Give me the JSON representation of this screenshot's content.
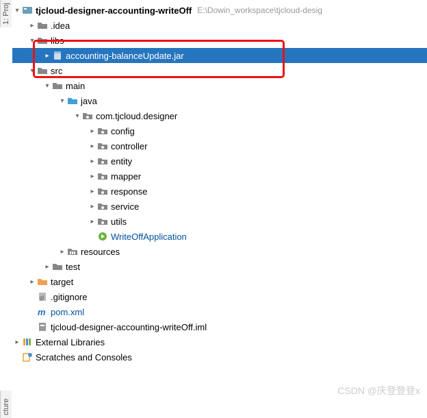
{
  "sidetabs": {
    "top": "1: Proj",
    "bottom": "cture"
  },
  "root": {
    "name": "tjcloud-designer-accounting-writeOff",
    "path": "E:\\Dowin_workspace\\tjcloud-desig"
  },
  "nodes": {
    "idea": ".idea",
    "libs": "libs",
    "jar": "accounting-balanceUpdate.jar",
    "src": "src",
    "main": "main",
    "java": "java",
    "pkg": "com.tjcloud.designer",
    "config": "config",
    "controller": "controller",
    "entity": "entity",
    "mapper": "mapper",
    "response": "response",
    "service": "service",
    "utils": "utils",
    "app": "WriteOffApplication",
    "resources": "resources",
    "test": "test",
    "target": "target",
    "gitignore": ".gitignore",
    "pom": "pom.xml",
    "iml": "tjcloud-designer-accounting-writeOff.iml",
    "extlib": "External Libraries",
    "scratches": "Scratches and Consoles"
  },
  "watermark": "CSDN @庆登登登x"
}
